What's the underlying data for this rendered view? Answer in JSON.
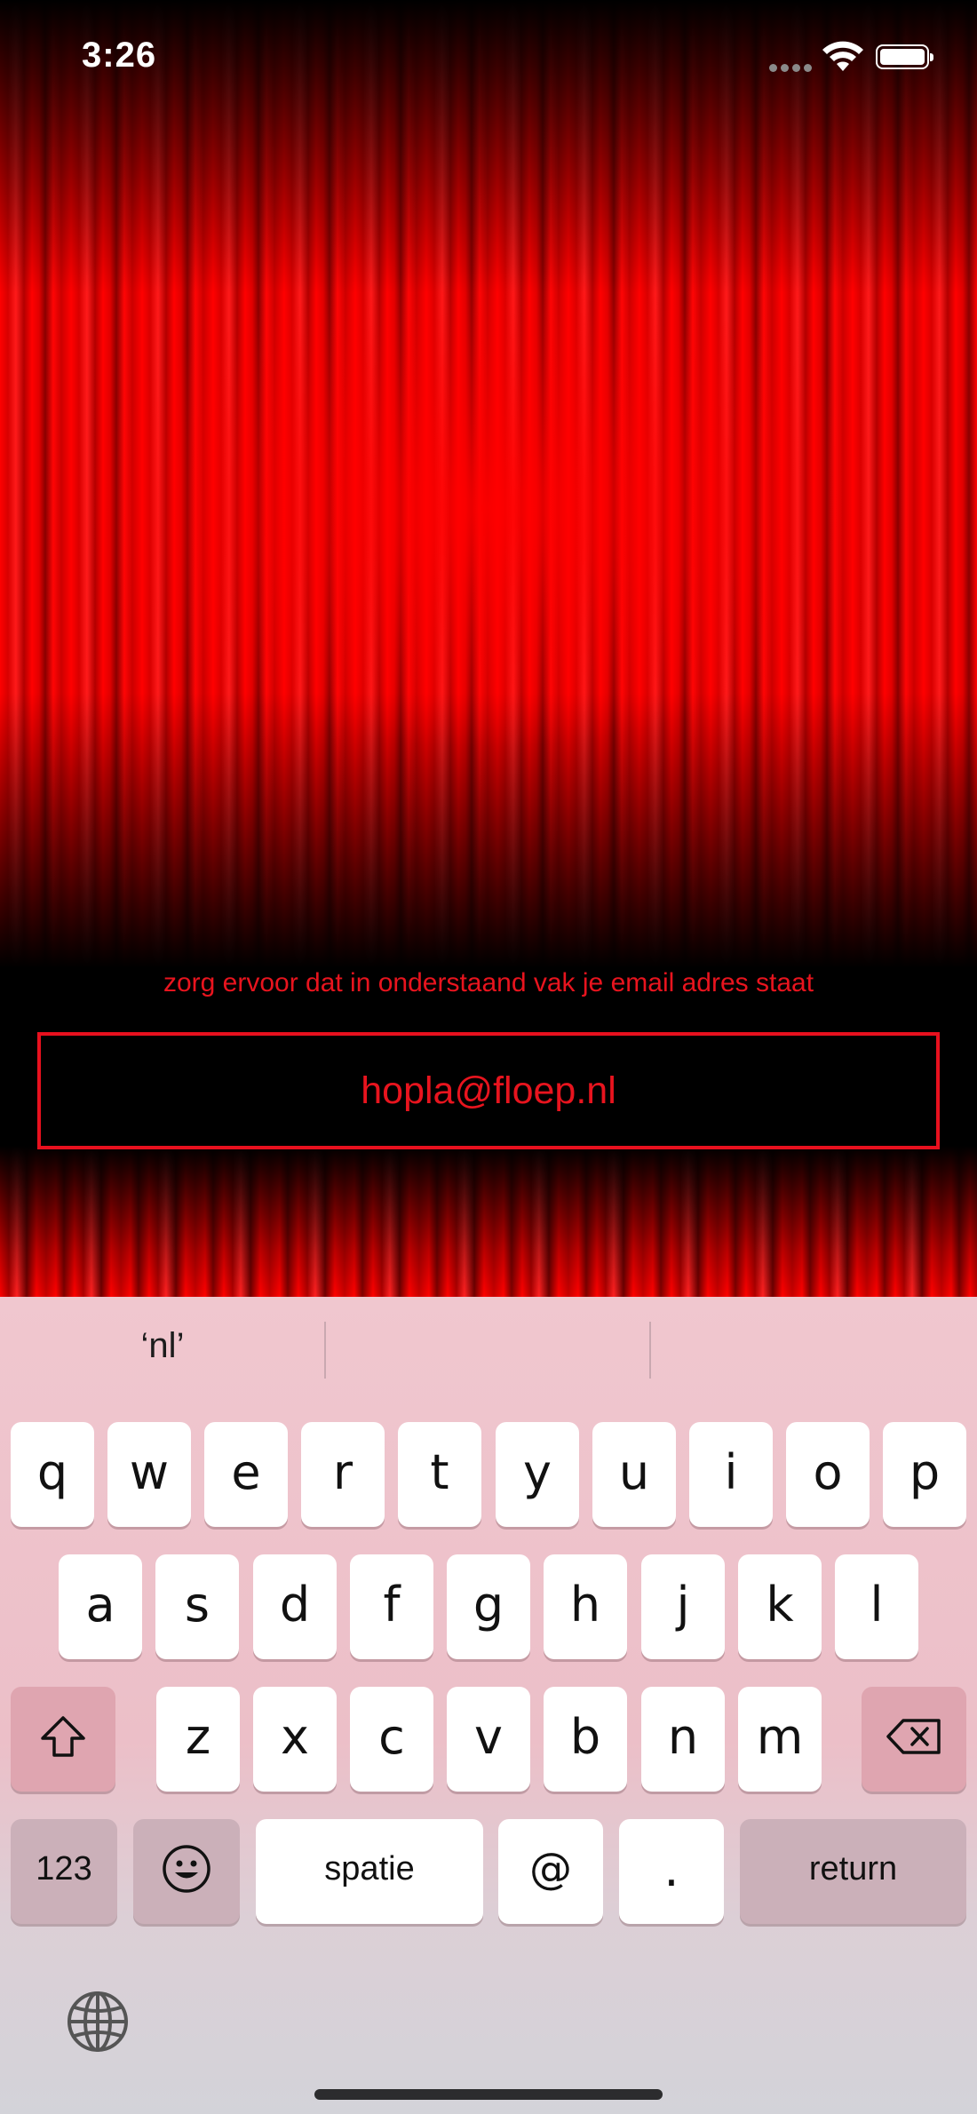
{
  "status_bar": {
    "time": "3:26"
  },
  "screen": {
    "instruction": "zorg ervoor dat in onderstaand vak je email adres staat",
    "email_value": "hopla@floep.nl"
  },
  "keyboard": {
    "suggestions": [
      "‘nl’",
      "",
      ""
    ],
    "row1": [
      "q",
      "w",
      "e",
      "r",
      "t",
      "y",
      "u",
      "i",
      "o",
      "p"
    ],
    "row2": [
      "a",
      "s",
      "d",
      "f",
      "g",
      "h",
      "j",
      "k",
      "l"
    ],
    "row3": [
      "z",
      "x",
      "c",
      "v",
      "b",
      "n",
      "m"
    ],
    "numbers_label": "123",
    "space_label": "spatie",
    "at_label": "@",
    "dot_label": ".",
    "return_label": "return"
  },
  "colors": {
    "accent": "#e8141e",
    "background": "#000000"
  }
}
